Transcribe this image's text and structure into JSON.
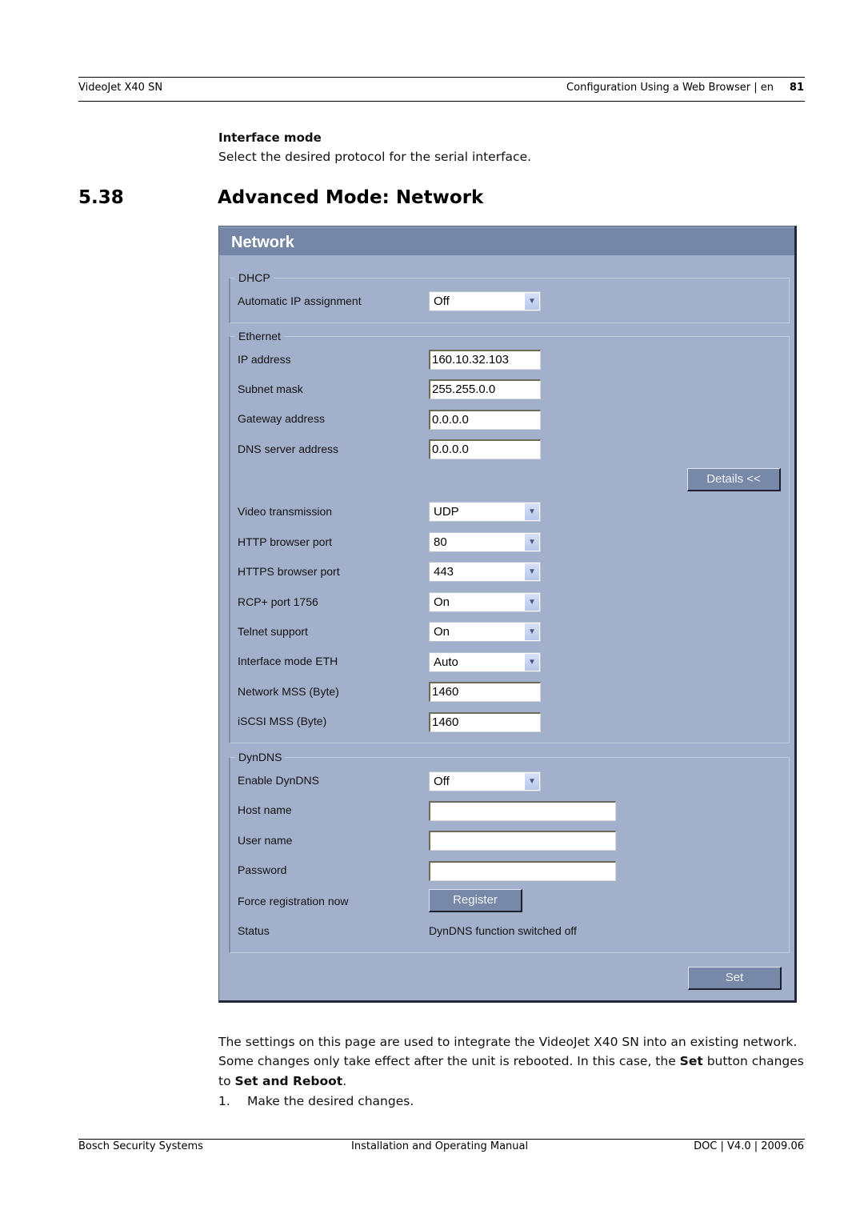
{
  "header": {
    "product": "VideoJet X40 SN",
    "section": "Configuration Using a Web Browser | en",
    "page_number": "81"
  },
  "intro": {
    "subheading": "Interface mode",
    "text": "Select the desired protocol for the serial interface."
  },
  "section": {
    "number": "5.38",
    "title": "Advanced Mode: Network"
  },
  "panel": {
    "title": "Network",
    "dhcp": {
      "legend": "DHCP",
      "automatic_ip": {
        "label": "Automatic IP assignment",
        "value": "Off"
      }
    },
    "ethernet": {
      "legend": "Ethernet",
      "ip_address": {
        "label": "IP address",
        "value": "160.10.32.103"
      },
      "subnet_mask": {
        "label": "Subnet mask",
        "value": "255.255.0.0"
      },
      "gateway": {
        "label": "Gateway address",
        "value": "0.0.0.0"
      },
      "dns": {
        "label": "DNS server address",
        "value": "0.0.0.0"
      },
      "details_button": "Details <<",
      "video_transmission": {
        "label": "Video transmission",
        "value": "UDP"
      },
      "http_port": {
        "label": "HTTP browser port",
        "value": "80"
      },
      "https_port": {
        "label": "HTTPS browser port",
        "value": "443"
      },
      "rcp_port": {
        "label": "RCP+ port 1756",
        "value": "On"
      },
      "telnet": {
        "label": "Telnet support",
        "value": "On"
      },
      "interface_mode": {
        "label": "Interface mode ETH",
        "value": "Auto"
      },
      "network_mss": {
        "label": "Network MSS (Byte)",
        "value": "1460"
      },
      "iscsi_mss": {
        "label": "iSCSI MSS (Byte)",
        "value": "1460"
      }
    },
    "dyndns": {
      "legend": "DynDNS",
      "enable": {
        "label": "Enable DynDNS",
        "value": "Off"
      },
      "host_name": {
        "label": "Host name",
        "value": ""
      },
      "user_name": {
        "label": "User name",
        "value": ""
      },
      "password": {
        "label": "Password",
        "value": ""
      },
      "force_registration": {
        "label": "Force registration now",
        "button": "Register"
      },
      "status": {
        "label": "Status",
        "value": "DynDNS function switched off"
      }
    },
    "set_button": "Set"
  },
  "body": {
    "p1_a": "The settings on this page are used to integrate the VideoJet X40 SN into an existing network.",
    "p1_b1": "Some changes only take effect after the unit is rebooted. In this case, the ",
    "p1_b_bold": "Set",
    "p1_b2": " button changes",
    "p1_c1": "to ",
    "p1_c_bold": "Set and Reboot",
    "p1_c2": ".",
    "step_number": "1.",
    "step_text": "Make the desired changes."
  },
  "footer": {
    "left": "Bosch Security Systems",
    "center": "Installation and Operating Manual",
    "right": "DOC | V4.0 | 2009.06"
  }
}
